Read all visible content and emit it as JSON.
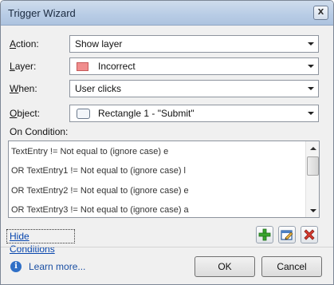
{
  "window": {
    "title": "Trigger Wizard",
    "close_symbol": "X"
  },
  "fields": {
    "action": {
      "label_accel": "A",
      "label_rest": "ction:",
      "value": "Show layer"
    },
    "layer": {
      "label_accel": "L",
      "label_rest": "ayer:",
      "value": "Incorrect",
      "swatch_color": "#f08d8d"
    },
    "when": {
      "label_accel": "W",
      "label_rest": "hen:",
      "value": "User clicks"
    },
    "object": {
      "label_accel": "O",
      "label_rest": "bject:",
      "value": "Rectangle 1 - \"Submit\""
    }
  },
  "conditions": {
    "label": "On Condition:",
    "rows": [
      "TextEntry != Not equal to (ignore case) e",
      "OR TextEntry1 != Not equal to (ignore case) l",
      "OR TextEntry2 != Not equal to (ignore case) e",
      "OR TextEntry3 != Not equal to (ignore case) a"
    ]
  },
  "toolbar": {
    "hide_conditions": "Hide Conditions",
    "add_icon": "plus-icon",
    "edit_icon": "edit-icon",
    "delete_icon": "delete-x-icon"
  },
  "footer": {
    "info_symbol": "i",
    "learn_more": "Learn more...",
    "ok": "OK",
    "cancel": "Cancel"
  }
}
